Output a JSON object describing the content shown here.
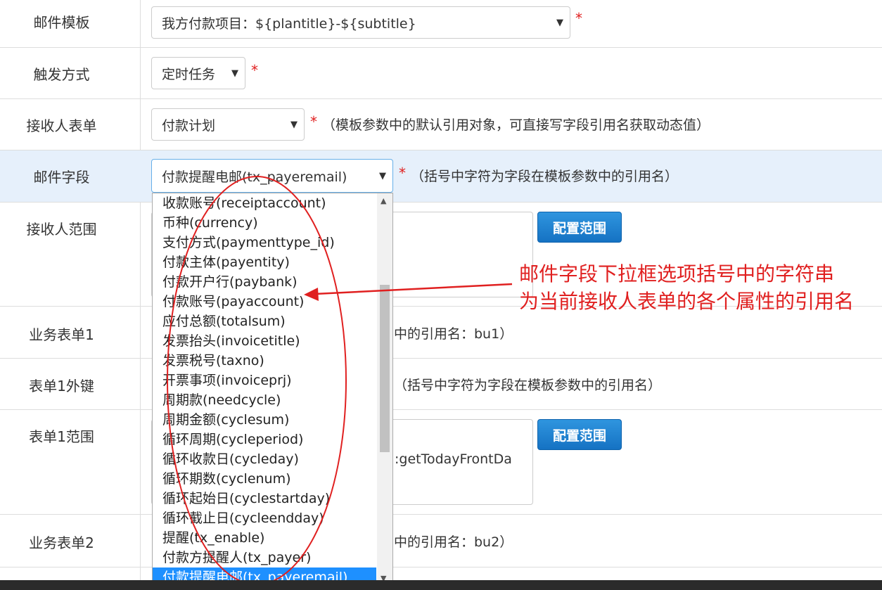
{
  "rows": {
    "mail_template": {
      "label": "邮件模板",
      "value": "我方付款项目：${plantitle}-${subtitle}"
    },
    "trigger": {
      "label": "触发方式",
      "value": "定时任务"
    },
    "recipient_form": {
      "label": "接收人表单",
      "value": "付款计划",
      "hint": "（模板参数中的默认引用对象，可直接写字段引用名获取动态值）"
    },
    "mail_field": {
      "label": "邮件字段",
      "value": "付款提醒电邮(tx_payeremail)",
      "hint": "（括号中字符为字段在模板参数中的引用名）"
    },
    "recipient_range": {
      "label": "接收人范围",
      "button": "配置范围"
    },
    "biz_form1": {
      "label": "业务表单1",
      "hint": "中的引用名：bu1）"
    },
    "form1_fk": {
      "label": "表单1外键",
      "hint": "（括号中字符为字段在模板参数中的引用名）"
    },
    "form1_range": {
      "label": "表单1范围",
      "button": "配置范围",
      "text": ":getTodayFrontDa"
    },
    "biz_form2": {
      "label": "业务表单2",
      "hint": "中的引用名：bu2）"
    }
  },
  "required_mark": "*",
  "dropdown": {
    "options": [
      "收款账号(receiptaccount)",
      "币种(currency)",
      "支付方式(paymenttype_id)",
      "付款主体(payentity)",
      "付款开户行(paybank)",
      "付款账号(payaccount)",
      "应付总额(totalsum)",
      "发票抬头(invoicetitle)",
      "发票税号(taxno)",
      "开票事项(invoiceprj)",
      "周期款(needcycle)",
      "周期金额(cyclesum)",
      "循环周期(cycleperiod)",
      "循环收款日(cycleday)",
      "循环期数(cyclenum)",
      "循环起始日(cyclestartday)",
      "循环截止日(cycleendday)",
      "提醒(tx_enable)",
      "付款方提醒人(tx_payer)",
      "付款提醒电邮(tx_payeremail)"
    ],
    "selected_index": 19
  },
  "annotation": {
    "line1": "邮件字段下拉框选项括号中的字符串",
    "line2": "为当前接收人表单的各个属性的引用名",
    "color": "#e02020"
  },
  "colors": {
    "highlight_row": "#e6f0fb",
    "button": "#1e7ccf",
    "selected_option": "#1e90ff"
  }
}
